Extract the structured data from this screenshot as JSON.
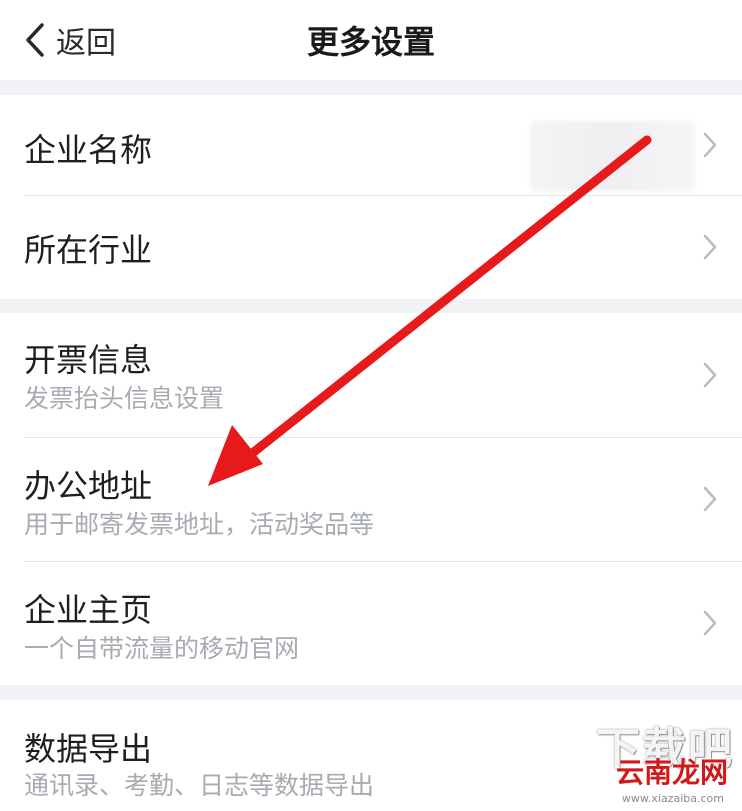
{
  "nav": {
    "back_label": "返回",
    "title": "更多设置"
  },
  "groups": [
    {
      "items": [
        {
          "title": "企业名称",
          "subtitle": ""
        },
        {
          "title": "所在行业",
          "subtitle": ""
        }
      ]
    },
    {
      "items": [
        {
          "title": "开票信息",
          "subtitle": "发票抬头信息设置"
        },
        {
          "title": "办公地址",
          "subtitle": "用于邮寄发票地址，活动奖品等"
        },
        {
          "title": "企业主页",
          "subtitle": "一个自带流量的移动官网"
        }
      ]
    },
    {
      "items": [
        {
          "title": "数据导出",
          "subtitle": "通讯录、考勤、日志等数据导出"
        }
      ]
    }
  ],
  "annotation": {
    "arrow_color": "#e8191b"
  },
  "watermark": {
    "top": "下载吧",
    "main": "云南龙网",
    "url": "www.xiazaiba.com"
  },
  "colors": {
    "background": "#f0f2f5",
    "row_background": "#ffffff",
    "subtitle": "#a7abb2",
    "chevron": "#b8bcc3"
  }
}
